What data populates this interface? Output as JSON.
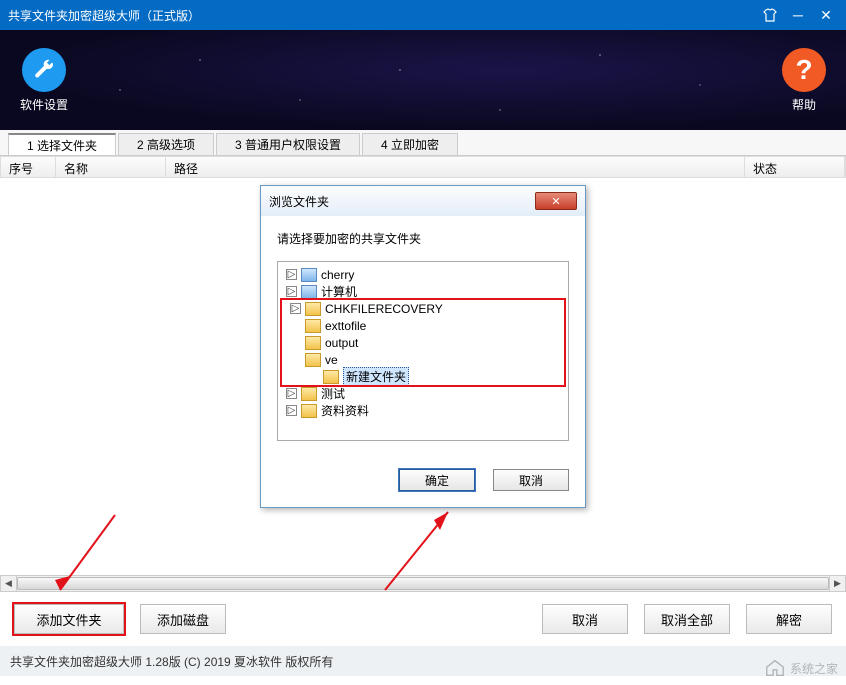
{
  "title": "共享文件夹加密超级大师（正式版）",
  "banner": {
    "settings_label": "软件设置",
    "help_label": "帮助",
    "help_symbol": "?"
  },
  "tabs": [
    {
      "label": "1 选择文件夹",
      "active": true
    },
    {
      "label": "2 高级选项",
      "active": false
    },
    {
      "label": "3 普通用户权限设置",
      "active": false
    },
    {
      "label": "4 立即加密",
      "active": false
    }
  ],
  "columns": {
    "index": "序号",
    "name": "名称",
    "path": "路径",
    "status": "状态"
  },
  "bottom_buttons": {
    "add_folder": "添加文件夹",
    "add_disk": "添加磁盘",
    "cancel_one": "取消",
    "cancel_all": "取消全部",
    "decrypt": "解密"
  },
  "statusbar": "共享文件夹加密超级大师  1.28版  (C) 2019 夏冰软件 版权所有",
  "watermark": "系统之家",
  "dialog": {
    "title": "浏览文件夹",
    "instruction": "请选择要加密的共享文件夹",
    "tree": [
      {
        "indent": 1,
        "twist": "▷",
        "icon": "folder-b",
        "label": "cherry"
      },
      {
        "indent": 1,
        "twist": "▷",
        "icon": "folder-b",
        "label": "计算机"
      },
      {
        "indent": 1,
        "twist": "▷",
        "icon": "folder-y",
        "label": "CHKFILERECOVERY",
        "boxed": true
      },
      {
        "indent": 1,
        "twist": "",
        "icon": "folder-y",
        "label": "exttofile",
        "boxed": true
      },
      {
        "indent": 1,
        "twist": "",
        "icon": "folder-y",
        "label": "output",
        "boxed": true
      },
      {
        "indent": 1,
        "twist": "",
        "icon": "folder-y",
        "label": "ve",
        "boxed": true
      },
      {
        "indent": 2,
        "twist": "",
        "icon": "folder-y",
        "label": "新建文件夹",
        "boxed": true,
        "selected": true
      },
      {
        "indent": 1,
        "twist": "▷",
        "icon": "folder-y",
        "label": "测试"
      },
      {
        "indent": 1,
        "twist": "▷",
        "icon": "folder-y",
        "label": "资料资料"
      }
    ],
    "ok": "确定",
    "cancel": "取消"
  }
}
